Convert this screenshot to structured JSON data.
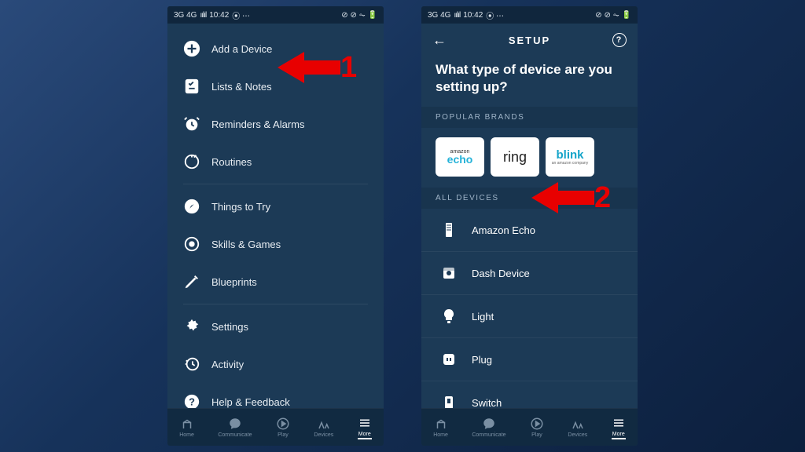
{
  "status": {
    "net": "3G 4G",
    "signal": "ıılıl",
    "time": "10:42",
    "extra": "⦿ ⋯",
    "right": "⊘ ⊘ ⏦ 🔋"
  },
  "left_menu": {
    "groups": [
      [
        {
          "icon": "plus-circle-icon",
          "label": "Add a Device"
        },
        {
          "icon": "checklist-icon",
          "label": "Lists & Notes"
        },
        {
          "icon": "alarm-icon",
          "label": "Reminders & Alarms"
        },
        {
          "icon": "routines-icon",
          "label": "Routines"
        }
      ],
      [
        {
          "icon": "compass-icon",
          "label": "Things to Try"
        },
        {
          "icon": "target-icon",
          "label": "Skills & Games"
        },
        {
          "icon": "pencil-icon",
          "label": "Blueprints"
        }
      ],
      [
        {
          "icon": "gear-icon",
          "label": "Settings"
        },
        {
          "icon": "history-icon",
          "label": "Activity"
        },
        {
          "icon": "help-icon",
          "label": "Help & Feedback"
        }
      ]
    ]
  },
  "setup": {
    "header": "SETUP",
    "title": "What type of device are you setting up?",
    "popular_label": "POPULAR BRANDS",
    "brands": {
      "echo_top": "amazon",
      "echo_bot": "echo",
      "ring": "ring",
      "blink_top": "blink",
      "blink_bot": "an amazon company"
    },
    "all_label": "ALL DEVICES",
    "devices": [
      {
        "icon": "echo-device-icon",
        "label": "Amazon Echo"
      },
      {
        "icon": "dash-icon",
        "label": "Dash Device"
      },
      {
        "icon": "bulb-icon",
        "label": "Light"
      },
      {
        "icon": "plug-icon",
        "label": "Plug"
      },
      {
        "icon": "switch-icon",
        "label": "Switch"
      }
    ]
  },
  "tabs": [
    {
      "icon": "home-icon",
      "label": "Home"
    },
    {
      "icon": "chat-icon",
      "label": "Communicate"
    },
    {
      "icon": "play-icon",
      "label": "Play"
    },
    {
      "icon": "devices-icon",
      "label": "Devices"
    },
    {
      "icon": "more-icon",
      "label": "More"
    }
  ],
  "annotations": {
    "one": "1",
    "two": "2"
  }
}
